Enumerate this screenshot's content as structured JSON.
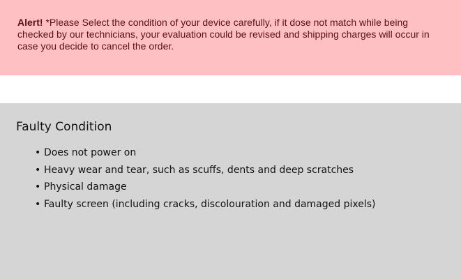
{
  "alert": {
    "label": "Alert!",
    "message": " *Please Select the condition of your device carefully, if it dose not match while being checked by our technicians, your evaluation could be revised and shipping charges will occur in case you decide to cancel the order."
  },
  "condition": {
    "title": "Faulty Condition",
    "items": [
      "Does not power on",
      "Heavy wear and tear, such as scuffs, dents and deep scratches",
      "Physical damage",
      "Faulty screen (including cracks, discolouration and damaged pixels)"
    ]
  },
  "colors": {
    "alert_background": "#ffc0c3",
    "alert_text": "#5a0f1a",
    "panel_background": "#d5d5d5"
  }
}
